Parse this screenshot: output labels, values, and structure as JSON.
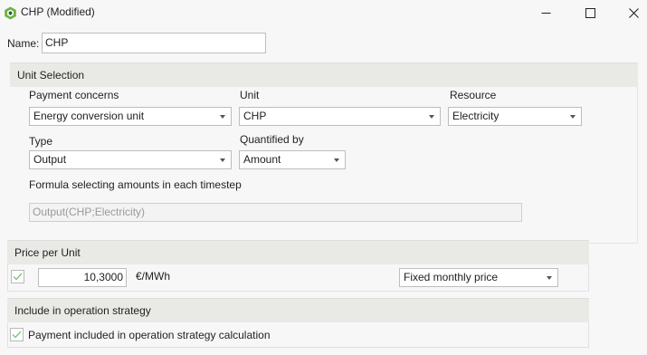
{
  "window": {
    "title": "CHP (Modified)"
  },
  "name": {
    "label": "Name:",
    "value": "CHP"
  },
  "unit_selection": {
    "header": "Unit Selection",
    "payment_concerns_label": "Payment concerns",
    "payment_concerns_value": "Energy conversion unit",
    "unit_label": "Unit",
    "unit_value": "CHP",
    "resource_label": "Resource",
    "resource_value": "Electricity",
    "type_label": "Type",
    "type_value": "Output",
    "quantified_by_label": "Quantified by",
    "quantified_by_value": "Amount",
    "formula_label": "Formula selecting amounts in each timestep",
    "formula_value": "Output(CHP;Electricity)"
  },
  "price": {
    "header": "Price per Unit",
    "enabled": true,
    "value": "10,3000",
    "unit": "€/MWh",
    "mode_value": "Fixed monthly price"
  },
  "strategy": {
    "header": "Include in operation strategy",
    "checkbox_label": "Payment included in operation strategy calculation",
    "checked": true
  },
  "colors": {
    "check": "#7bc67b",
    "logo_green": "#6cb33f",
    "logo_dark": "#2e5e1f"
  }
}
